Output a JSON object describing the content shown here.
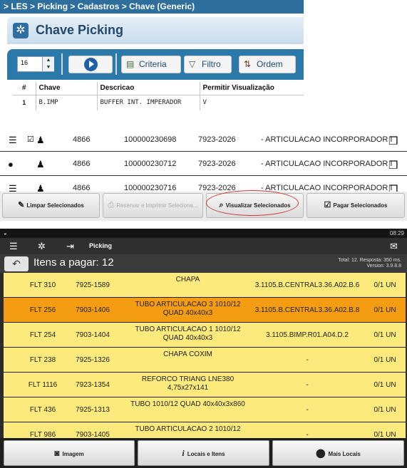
{
  "section1": {
    "breadcrumb": "> LES > Picking > Cadastros > Chave (Generic)",
    "title": "Chave Picking",
    "page_size": "16",
    "toolbar": {
      "criteria": "Criteria",
      "filtro": "Filtro",
      "ordem": "Ordem"
    },
    "columns": [
      "#",
      "Chave",
      "Descricao",
      "Permitir Visualização"
    ],
    "rows": [
      {
        "num": "1",
        "chave": "B.IMP",
        "descricao": "BUFFER INT. IMPERADOR",
        "permitir": "V"
      }
    ]
  },
  "section2": {
    "rows": [
      {
        "c1": "4866",
        "c2": "100000230698",
        "c3": "7923-2026",
        "c4": "- ARTICULACAO INCORPORADOR I"
      },
      {
        "c1": "4866",
        "c2": "100000230712",
        "c3": "7923-2026",
        "c4": "- ARTICULACAO INCORPORADOR I"
      },
      {
        "c1": "4866",
        "c2": "100000230716",
        "c3": "7923-2026",
        "c4": "- ARTICULACAO INCORPORADOR I"
      }
    ],
    "buttons": {
      "limpar": "Limpar Selecionados",
      "reservar": "Reservar e Imprimir Seleciona...",
      "visualizar": "Visualizar Selecionados",
      "pagar": "Pagar Selecionados"
    }
  },
  "section3": {
    "time": "08:29",
    "app_title": "Picking",
    "items_title": "Itens a pagar: 12",
    "info_line1": "Total: 12. Resposta: 350 ms.",
    "info_line2": "Version: 3.9.8.8",
    "rows": [
      {
        "code": "FLT 310",
        "part": "7925-1589",
        "desc": "CHAPA",
        "loc": "3.1105.B.CENTRAL3.36.A02.B.6",
        "qty": "0/1 UN"
      },
      {
        "code": "FLT 256",
        "part": "7903-1406",
        "desc": "TUBO ARTICULACAO 3 1010/12 QUAD 40x40x3",
        "loc": "3.1105.B.CENTRAL3.36.A02.B.8",
        "qty": "0/1 UN"
      },
      {
        "code": "FLT 254",
        "part": "7903-1404",
        "desc": "TUBO ARTICULACAO 1 1010/12 QUAD 40x40x3",
        "loc": "3.1105.BIMP.R01.A04.D.2",
        "qty": "0/1 UN"
      },
      {
        "code": "FLT 238",
        "part": "7925-1326",
        "desc": "CHAPA COXIM",
        "loc": "-",
        "qty": "0/1 UN"
      },
      {
        "code": "FLT 1116",
        "part": "7923-1354",
        "desc": "REFORCO TRIANG LNE380 4,75x27x141",
        "loc": "-",
        "qty": "0/1 UN"
      },
      {
        "code": "FLT 436",
        "part": "7925-1313",
        "desc": "TUBO 1010/12 QUAD 40x40x3x860",
        "loc": "-",
        "qty": "0/1 UN"
      },
      {
        "code": "FLT 986",
        "part": "7903-1405",
        "desc": "TUBO ARTICULACAO 2 1010/12",
        "loc": "-",
        "qty": "0/1 UN"
      }
    ],
    "buttons": {
      "imagem": "Imagem",
      "locais": "Locais e Itens",
      "mais": "Mais Locais"
    },
    "colors": {
      "row": "#fdea7c",
      "selected": "#f59d12"
    }
  }
}
